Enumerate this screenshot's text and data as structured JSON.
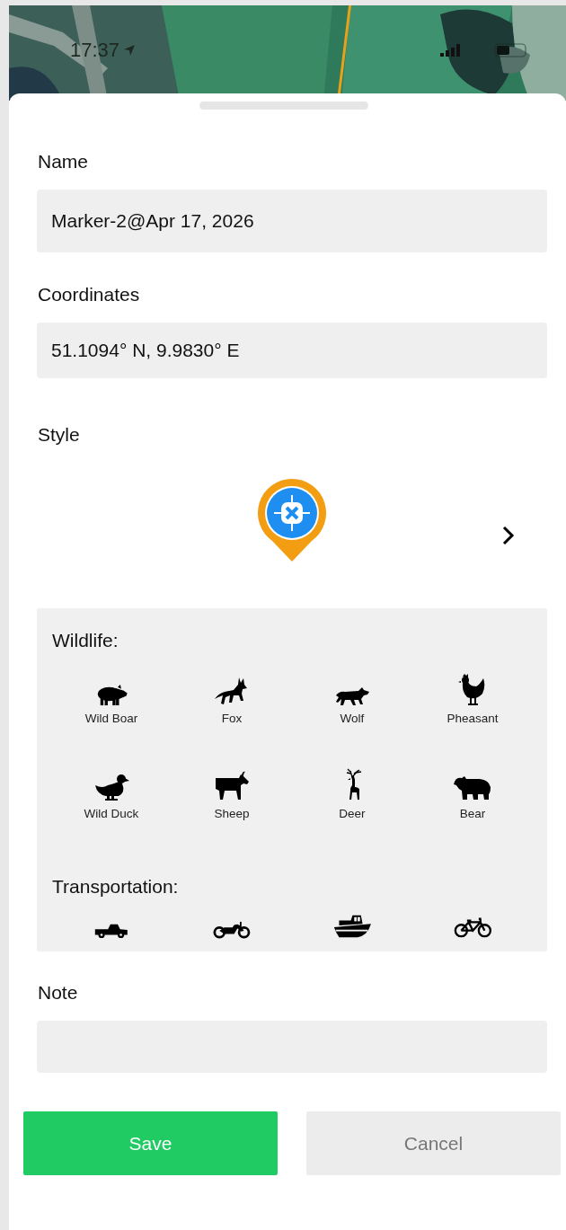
{
  "status_bar": {
    "time": "17:37"
  },
  "form": {
    "name": {
      "label": "Name",
      "value": "Marker-2@Apr 17, 2026"
    },
    "coordinates": {
      "label": "Coordinates",
      "value": "51.1094° N, 9.9830° E"
    },
    "style": {
      "label": "Style"
    },
    "categories": [
      {
        "title": "Wildlife:",
        "items": [
          {
            "kind": "boar",
            "label": "Wild Boar"
          },
          {
            "kind": "fox",
            "label": "Fox"
          },
          {
            "kind": "wolf",
            "label": "Wolf"
          },
          {
            "kind": "chicken",
            "label": "Pheasant"
          },
          {
            "kind": "duck",
            "label": "Wild Duck"
          },
          {
            "kind": "goat",
            "label": "Sheep"
          },
          {
            "kind": "deer",
            "label": "Deer"
          },
          {
            "kind": "bear",
            "label": "Bear"
          }
        ]
      },
      {
        "title": "Transportation:",
        "items": [
          {
            "kind": "truck"
          },
          {
            "kind": "motorcycle"
          },
          {
            "kind": "boat"
          },
          {
            "kind": "bicycle"
          }
        ]
      }
    ],
    "note": {
      "label": "Note"
    }
  },
  "buttons": [
    {
      "kind": "primary",
      "label": "Save"
    },
    {
      "kind": "secondary",
      "label": "Cancel"
    }
  ]
}
